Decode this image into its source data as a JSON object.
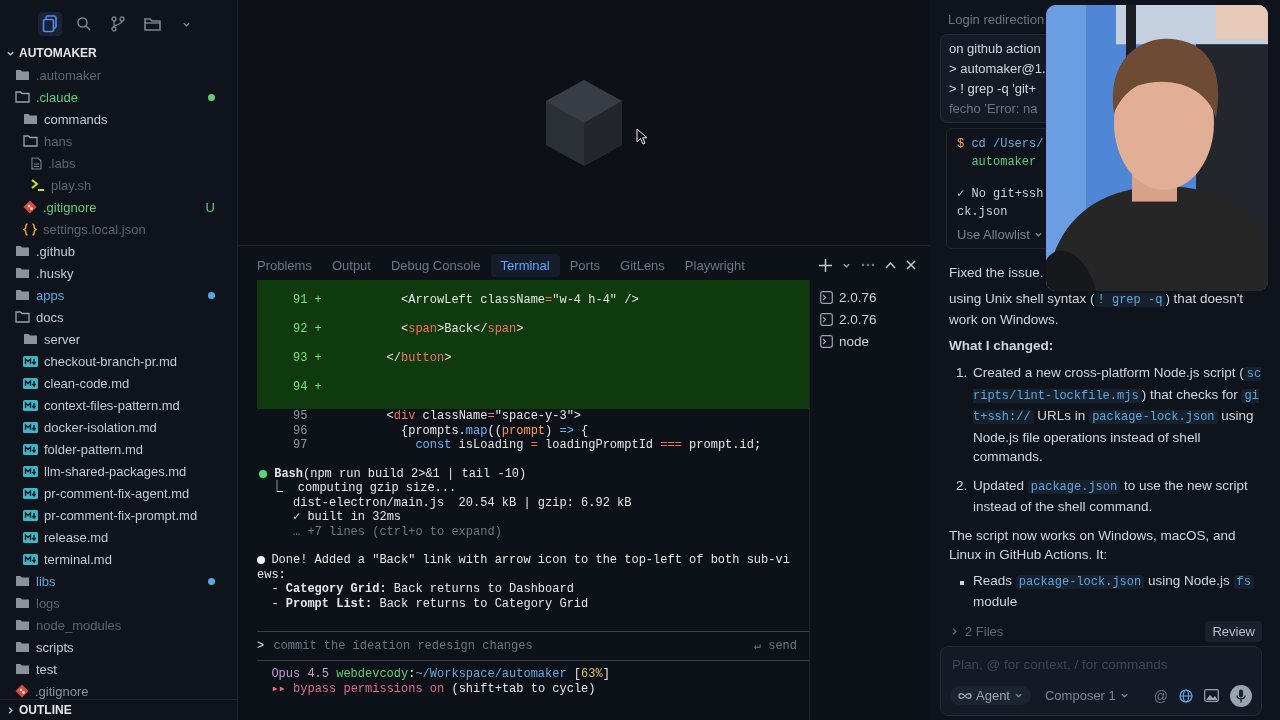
{
  "sidebar": {
    "toolbar": [
      {
        "kind": "files",
        "selected": true
      },
      {
        "kind": "search",
        "selected": false
      },
      {
        "kind": "branch",
        "selected": false
      },
      {
        "kind": "folder",
        "selected": false
      },
      {
        "kind": "chevron",
        "selected": false
      }
    ],
    "explorer": {
      "title": "AUTOMAKER",
      "expanded": true,
      "items": [
        {
          "name": ".automaker",
          "kind": "folder",
          "expanded": false,
          "color": "#5b6474"
        },
        {
          "name": ".claude",
          "kind": "folder",
          "expanded": true,
          "color": "#5ccf7a",
          "dot": true,
          "children": [
            {
              "name": "commands",
              "kind": "folder",
              "expanded": false,
              "color": "#c3c9d3"
            },
            {
              "name": "hans",
              "kind": "folder",
              "expanded": true,
              "color": "#5b6474",
              "children": [
                {
                  "name": ".labs",
                  "kind": "file",
                  "color": "#5b6474"
                },
                {
                  "name": "play.sh",
                  "kind": "shell",
                  "color": "#5b6474"
                }
              ]
            },
            {
              "name": ".gitignore",
              "kind": "git",
              "color": "#5ccf7a",
              "badge": "U"
            },
            {
              "name": "settings.local.json",
              "kind": "json",
              "color": "#5b6474"
            }
          ]
        },
        {
          "name": ".github",
          "kind": "folder",
          "expanded": false,
          "color": "#c3c9d3"
        },
        {
          "name": ".husky",
          "kind": "folder",
          "expanded": false,
          "color": "#c3c9d3"
        },
        {
          "name": "apps",
          "kind": "folder",
          "expanded": false,
          "color": "#5aa7e0",
          "dot": true
        },
        {
          "name": "docs",
          "kind": "folder",
          "expanded": true,
          "color": "#c3c9d3",
          "children": [
            {
              "name": "server",
              "kind": "folder",
              "expanded": false,
              "color": "#c3c9d3"
            },
            {
              "name": "checkout-branch-pr.md",
              "kind": "markdown",
              "color": "#c3c9d3"
            },
            {
              "name": "clean-code.md",
              "kind": "markdown",
              "color": "#c3c9d3"
            },
            {
              "name": "context-files-pattern.md",
              "kind": "markdown",
              "color": "#c3c9d3"
            },
            {
              "name": "docker-isolation.md",
              "kind": "markdown",
              "color": "#c3c9d3"
            },
            {
              "name": "folder-pattern.md",
              "kind": "markdown",
              "color": "#c3c9d3"
            },
            {
              "name": "llm-shared-packages.md",
              "kind": "markdown",
              "color": "#c3c9d3"
            },
            {
              "name": "pr-comment-fix-agent.md",
              "kind": "markdown",
              "color": "#c3c9d3"
            },
            {
              "name": "pr-comment-fix-prompt.md",
              "kind": "markdown",
              "color": "#c3c9d3"
            },
            {
              "name": "release.md",
              "kind": "markdown",
              "color": "#c3c9d3"
            },
            {
              "name": "terminal.md",
              "kind": "markdown",
              "color": "#c3c9d3"
            }
          ]
        },
        {
          "name": "libs",
          "kind": "folder",
          "expanded": false,
          "color": "#5aa7e0",
          "dot": true
        },
        {
          "name": "logs",
          "kind": "folder",
          "expanded": false,
          "color": "#5b6474"
        },
        {
          "name": "node_modules",
          "kind": "folder",
          "expanded": false,
          "color": "#5b6474"
        },
        {
          "name": "scripts",
          "kind": "folder",
          "expanded": false,
          "color": "#c3c9d3"
        },
        {
          "name": "test",
          "kind": "folder",
          "expanded": false,
          "color": "#c3c9d3"
        },
        {
          "name": ".gitignore",
          "kind": "git",
          "color": "#8b929e"
        }
      ]
    },
    "outline": {
      "title": "OUTLINE",
      "expanded": false
    }
  },
  "panel": {
    "tabs": [
      {
        "label": "Problems",
        "selected": false
      },
      {
        "label": "Output",
        "selected": false
      },
      {
        "label": "Debug Console",
        "selected": false
      },
      {
        "label": "Terminal",
        "selected": true
      },
      {
        "label": "Ports",
        "selected": false
      },
      {
        "label": "GitLens",
        "selected": false
      },
      {
        "label": "Playwright",
        "selected": false
      }
    ],
    "terminal": {
      "diff": [
        {
          "number": "91",
          "sign": "+",
          "added": true,
          "tokens": [
            {
              "t": "          <ArrowLeft className"
            },
            {
              "t": "=",
              "color": "#f47067"
            },
            {
              "t": "\"w-4 h-4\" />"
            }
          ]
        },
        {
          "number": "92",
          "sign": "+",
          "added": true,
          "tokens": [
            {
              "t": "          <"
            },
            {
              "t": "span",
              "color": "#f47067"
            },
            {
              "t": ">Back</"
            },
            {
              "t": "span",
              "color": "#f47067"
            },
            {
              "t": ">"
            }
          ]
        },
        {
          "number": "93",
          "sign": "+",
          "added": true,
          "tokens": [
            {
              "t": "        </"
            },
            {
              "t": "button",
              "color": "#f47067"
            },
            {
              "t": ">"
            }
          ]
        },
        {
          "number": "94",
          "sign": "+",
          "added": true
        },
        {
          "number": "95",
          "added": false,
          "tokens": [
            {
              "t": "        <"
            },
            {
              "t": "div",
              "color": "#f47067"
            },
            {
              "t": " className"
            },
            {
              "t": "=",
              "color": "#f47067"
            },
            {
              "t": "\"space-y-3\">"
            }
          ]
        },
        {
          "number": "96",
          "added": false,
          "tokens": [
            {
              "t": "          {prompts."
            },
            {
              "t": "map",
              "color": "#6cb6ff"
            },
            {
              "t": "(("
            },
            {
              "t": "prompt",
              "color": "#f69d50"
            },
            {
              "t": ") "
            },
            {
              "t": "=>",
              "color": "#6cb6ff"
            },
            {
              "t": " {"
            }
          ]
        },
        {
          "number": "97",
          "added": false,
          "tokens": [
            {
              "t": "            const",
              "color": "#6cb6ff"
            },
            {
              "t": " isLoading "
            },
            {
              "t": "=",
              "color": "#f47067"
            },
            {
              "t": " loadingPromptId "
            },
            {
              "t": "===",
              "color": "#f47067"
            },
            {
              "t": " prompt.id;"
            }
          ]
        }
      ],
      "messages": [
        {
          "color": "#4ade80",
          "text": "**Bash**(npm run build 2>&1 | tail -10)",
          "output": [
            {
              "text": "⎿  computing gzip size...",
              "dim": false
            },
            {
              "text": "   dist-electron/main.js  20.54 kB | gzip: 6.92 kB",
              "dim": false
            },
            {
              "text": "   ✓ built in 32ms",
              "dim": false
            },
            {
              "text": "   … +7 lines (ctrl+o to expand)",
              "dim": true
            }
          ]
        },
        {
          "color": "#f3f4f6",
          "text": "Done! Added a \"Back\" link with arrow icon to the top-left of both sub-views:",
          "bullets": [
            "  - **Category Grid:** Back returns to Dashboard",
            "  - **Prompt List:** Back returns to Category Grid"
          ]
        }
      ],
      "prompt": {
        "symbol": ">",
        "placeholder": "commit the ideation redesign changes",
        "hint": "↵ send"
      },
      "status": [
        [
          {
            "t": "Opus 4.5",
            "color": "#c59ad8"
          },
          {
            "t": " webdevcody",
            "color": "#5ccf7a"
          },
          {
            "t": ":"
          },
          {
            "t": "~/Workspace/automaker",
            "color": "#6aa8e0"
          },
          {
            "t": " ["
          },
          {
            "t": "63%",
            "color": "#e3c15b"
          },
          {
            "t": "]"
          }
        ],
        [
          {
            "t": "▸▸ bypass permissions on",
            "color": "#e06b8a"
          },
          {
            "t": " (shift+tab to cycle)"
          }
        ]
      ]
    },
    "sessions": [
      {
        "label": "2.0.76"
      },
      {
        "label": "2.0.76"
      },
      {
        "label": "node"
      }
    ]
  },
  "chat": {
    "title": "Login redirection",
    "user_message": [
      "on github action",
      "> automaker@1.",
      "> ! grep -q 'git+",
      "fecho 'Error: na"
    ],
    "command": {
      "input": [
        [
          {
            "t": "$",
            "color": "#f69d50"
          },
          {
            "t": " cd /Users/",
            "color": "#6aa8e0"
          }
        ],
        [
          {
            "t": "  automaker",
            "color": "#5ccf7a"
          }
        ]
      ],
      "output": [
        "✓ No git+ssh",
        "ck.json"
      ],
      "action": "Use Allowlist"
    },
    "blocks": [
      {
        "kind": "paragraph",
        "parts": [
          {
            "text": "Fixed the issue.",
            "code": false
          }
        ]
      },
      {
        "kind": "paragraph",
        "parts": [
          {
            "text": "using Unix shell syntax (",
            "code": false
          },
          {
            "text": "! grep -q",
            "code": true
          },
          {
            "text": ") that doesn't work on Windows.",
            "code": false
          }
        ]
      },
      {
        "kind": "heading",
        "text": "What I changed:"
      },
      {
        "kind": "ordered",
        "items": [
          {
            "number": "1.",
            "parts": [
              {
                "text": "Created a new cross-platform Node.js script (",
                "code": false
              },
              {
                "text": "scripts/lint-lockfile.mjs",
                "code": true
              },
              {
                "text": ") that checks for ",
                "code": false
              },
              {
                "text": "git+ssh://",
                "code": true
              },
              {
                "text": " URLs in ",
                "code": false
              },
              {
                "text": "package-lock.json",
                "code": true
              },
              {
                "text": " using Node.js file operations instead of shell commands.",
                "code": false
              }
            ]
          },
          {
            "number": "2.",
            "parts": [
              {
                "text": "Updated ",
                "code": false
              },
              {
                "text": "package.json",
                "code": true
              },
              {
                "text": " to use the new script instead of the shell command.",
                "code": false
              }
            ]
          }
        ]
      },
      {
        "kind": "paragraph",
        "parts": [
          {
            "text": "The script now works on Windows, macOS, and Linux in GitHub Actions. It:",
            "code": false
          }
        ]
      },
      {
        "kind": "bullets",
        "items": [
          {
            "parts": [
              {
                "text": "Reads ",
                "code": false
              },
              {
                "text": "package-lock.json",
                "code": true
              },
              {
                "text": " using Node.js ",
                "code": false
              },
              {
                "text": "fs",
                "code": true
              },
              {
                "text": " module",
                "code": false
              }
            ]
          }
        ]
      }
    ],
    "files": {
      "label": "2 Files",
      "expanded": false,
      "action": "Review"
    },
    "composer": {
      "placeholder": "Plan, @ for context, / for commands",
      "mode": "Agent",
      "model": "Composer 1",
      "mention": "@"
    },
    "webcam": {
      "kind": "picture"
    }
  }
}
